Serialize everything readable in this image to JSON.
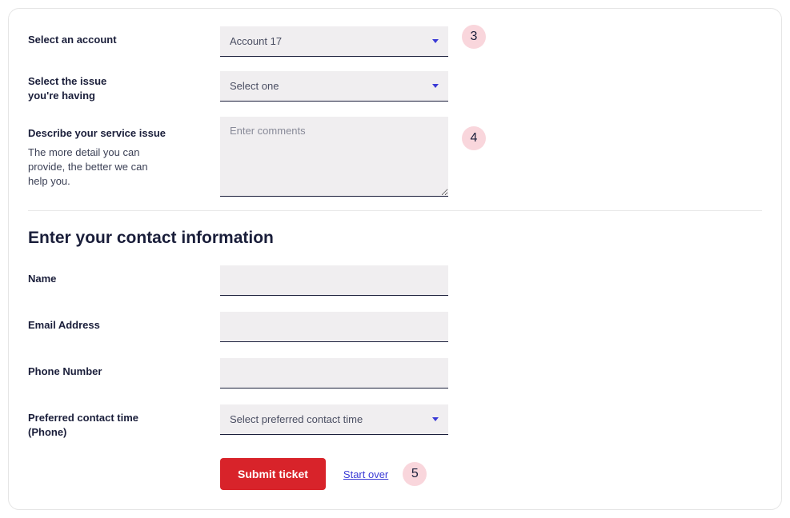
{
  "form": {
    "account": {
      "label": "Select an account",
      "value": "Account 17"
    },
    "issue": {
      "label": "Select the issue you're having",
      "placeholder": "Select one"
    },
    "describe": {
      "label": "Describe your service issue",
      "subtext": "The more detail you can provide, the better we can help you.",
      "placeholder": "Enter comments"
    }
  },
  "contact": {
    "heading": "Enter your contact information",
    "name_label": "Name",
    "email_label": "Email Address",
    "phone_label": "Phone Number",
    "preferred_time": {
      "label": "Preferred contact time (Phone)",
      "placeholder": "Select preferred contact time"
    }
  },
  "actions": {
    "submit": "Submit ticket",
    "start_over": "Start over"
  },
  "callouts": {
    "c3": "3",
    "c4": "4",
    "c5": "5"
  }
}
